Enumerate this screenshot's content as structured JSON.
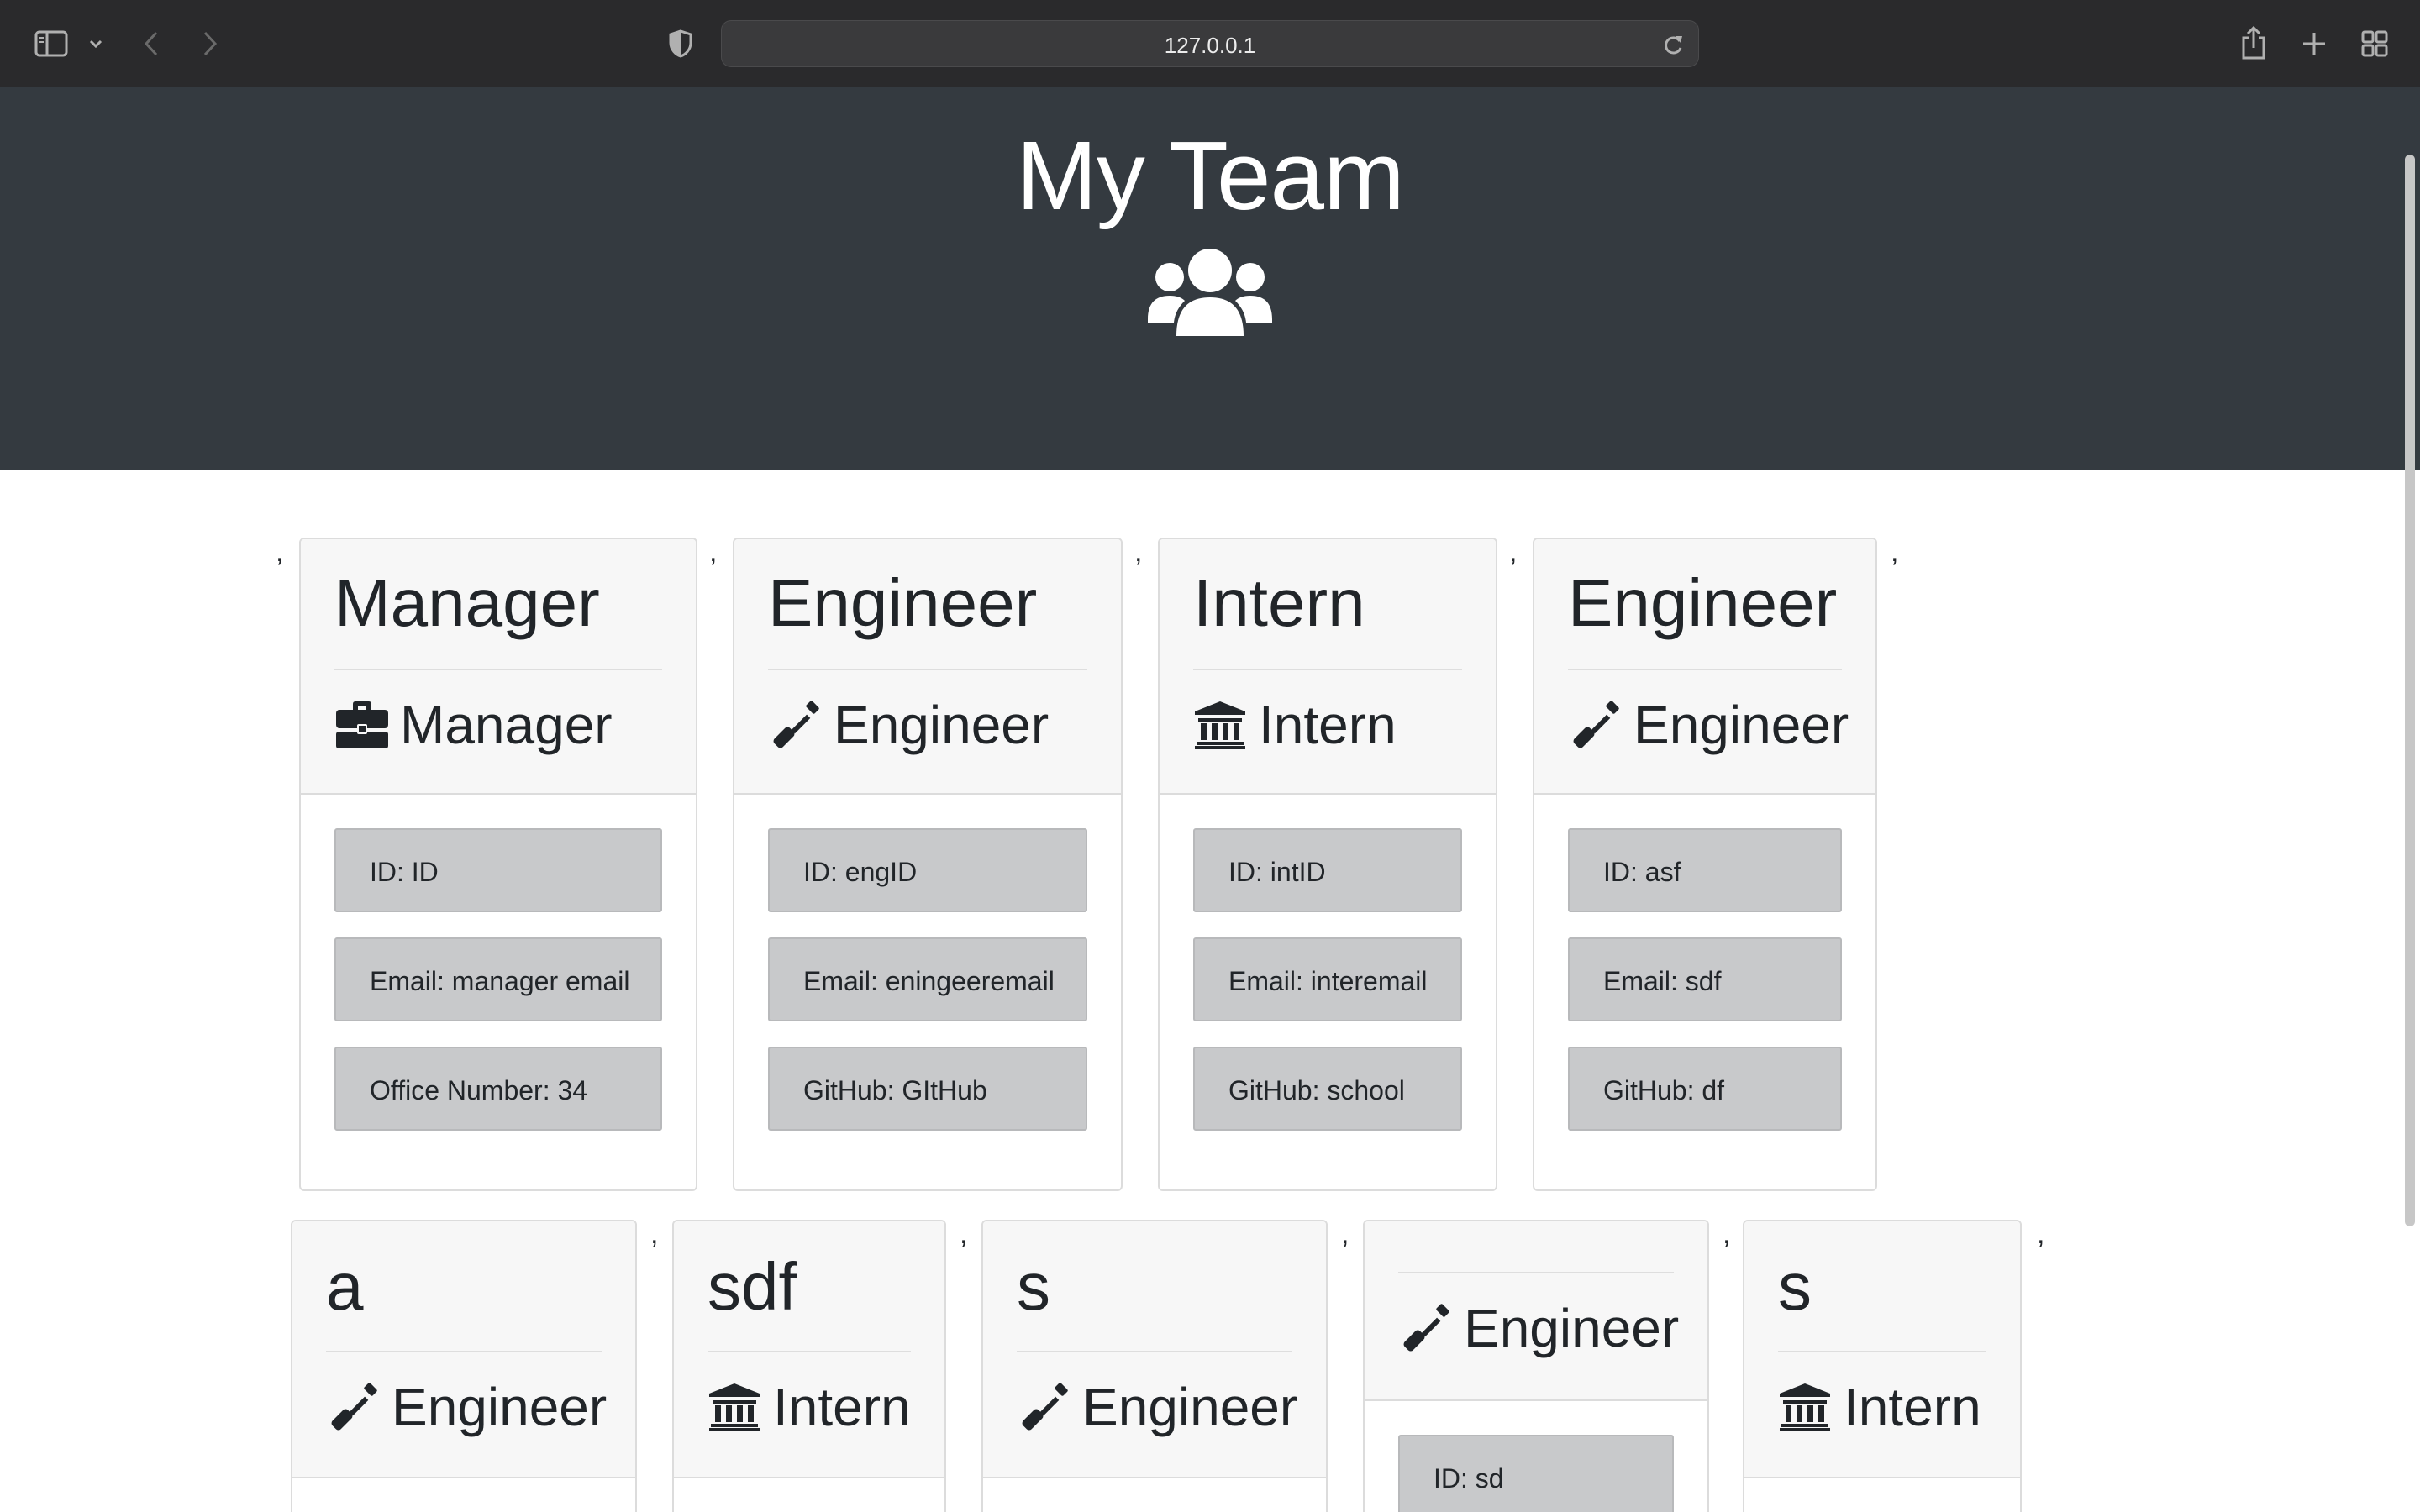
{
  "browser": {
    "url": "127.0.0.1",
    "icons": [
      "sidebar-icon",
      "chevron-down-icon",
      "back-arrow-icon",
      "forward-arrow-icon",
      "shield-icon",
      "reload-icon",
      "share-icon",
      "new-tab-icon",
      "tab-overview-icon"
    ]
  },
  "header": {
    "title": "My Team",
    "icon": "users-icon",
    "background": "#343a40"
  },
  "separator": ",",
  "cards": [
    {
      "name": "Manager",
      "role": "Manager",
      "role_icon": "briefcase-icon",
      "id": "ID: ID",
      "email": "Email: manager email",
      "extra": "Office Number: 34"
    },
    {
      "name": "Engineer",
      "role": "Engineer",
      "role_icon": "screwdriver-icon",
      "id": "ID: engID",
      "email": "Email: eningeeremail",
      "extra": "GitHub: GItHub"
    },
    {
      "name": "Intern",
      "role": "Intern",
      "role_icon": "university-icon",
      "id": "ID: intID",
      "email": "Email: interemail",
      "extra": "GitHub: school"
    },
    {
      "name": "Engineer",
      "role": "Engineer",
      "role_icon": "screwdriver-icon",
      "id": "ID: asf",
      "email": "Email: sdf",
      "extra": "GitHub: df"
    },
    {
      "name": "a",
      "role": "Engineer",
      "role_icon": "screwdriver-icon"
    },
    {
      "name": "sdf",
      "role": "Intern",
      "role_icon": "university-icon"
    },
    {
      "name": "s",
      "role": "Engineer",
      "role_icon": "screwdriver-icon"
    },
    {
      "name": "",
      "role": "Engineer",
      "role_icon": "screwdriver-icon",
      "id": "ID: sd"
    },
    {
      "name": "s",
      "role": "Intern",
      "role_icon": "university-icon"
    }
  ]
}
